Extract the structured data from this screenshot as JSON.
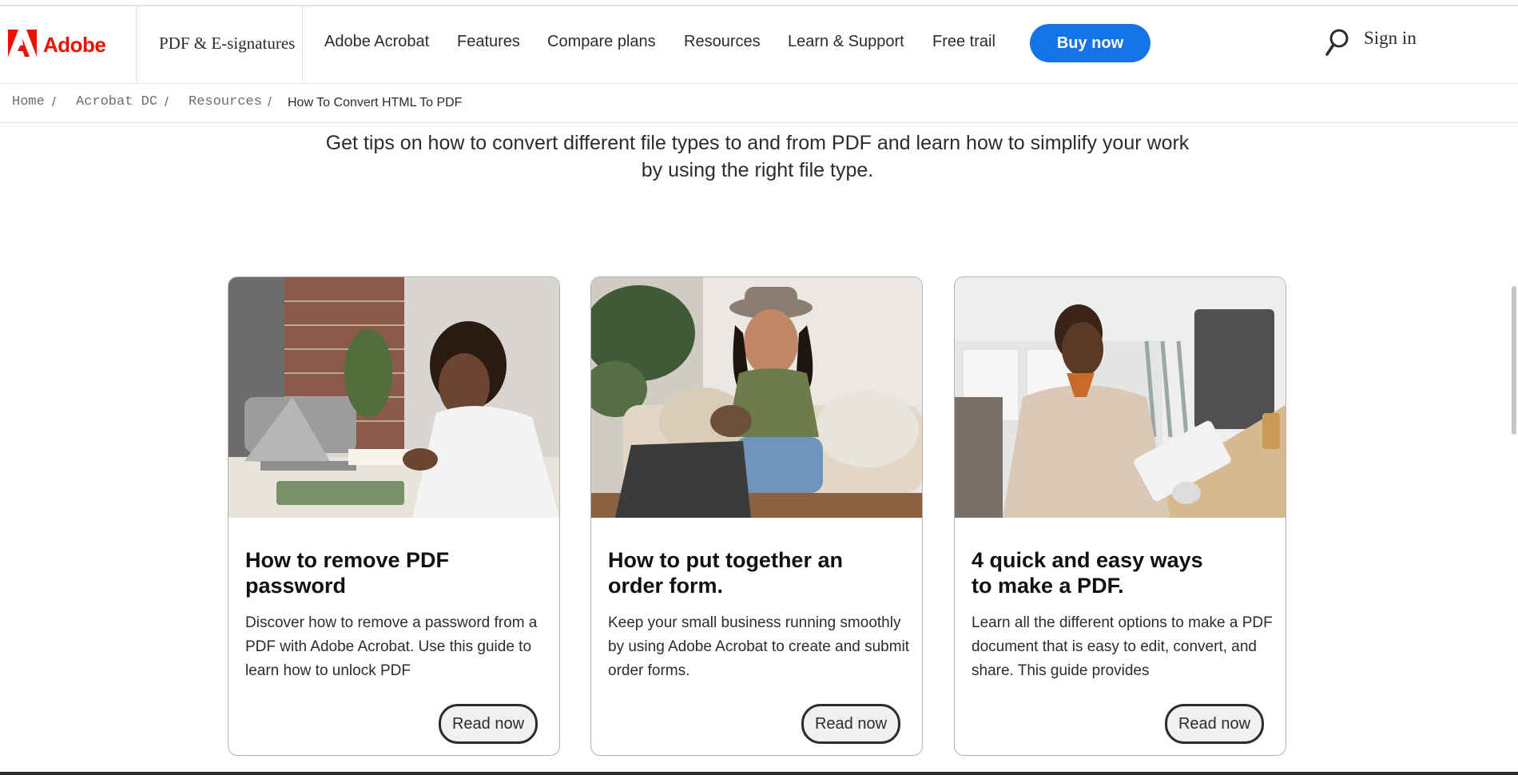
{
  "header": {
    "brand_name": "Adobe",
    "brand_color": "#eb1000",
    "product_label": "PDF & E-signatures",
    "nav_links": [
      "Adobe Acrobat",
      "Features",
      "Compare plans",
      "Resources",
      "Learn & Support",
      "Free trail"
    ],
    "buy_button": "Buy now",
    "buy_button_color": "#1473e6",
    "search_icon": "search-icon",
    "sign_in": "Sign in"
  },
  "breadcrumb": {
    "items": [
      "Home",
      "Acrobat DC",
      "Resources"
    ],
    "separator": "/",
    "current": "How To Convert HTML To PDF"
  },
  "intro": {
    "line1": "Get tips on how to convert different file types to and from PDF and learn how to simplify your work",
    "line2": "by using the right file type."
  },
  "cards": [
    {
      "title_line1": "How to remove PDF",
      "title_line2": "password",
      "desc_line1": "Discover how to remove a password from a",
      "desc_line2": "PDF with Adobe Acrobat. Use this guide to",
      "desc_line3": "learn how to unlock PDF",
      "button": "Read now"
    },
    {
      "title_line1": "How to put together an",
      "title_line2": "order form.",
      "desc_line1": "Keep your small business running smoothly",
      "desc_line2": "by using Adobe Acrobat to create and submit",
      "desc_line3": "order forms.",
      "button": "Read now"
    },
    {
      "title_line1": "4 quick and easy ways",
      "title_line2": "to make a PDF.",
      "desc_line1": "Learn all the different options to make a PDF",
      "desc_line2": "document that is easy to edit, convert, and",
      "desc_line3": "share. This guide provides",
      "button": "Read now"
    }
  ]
}
